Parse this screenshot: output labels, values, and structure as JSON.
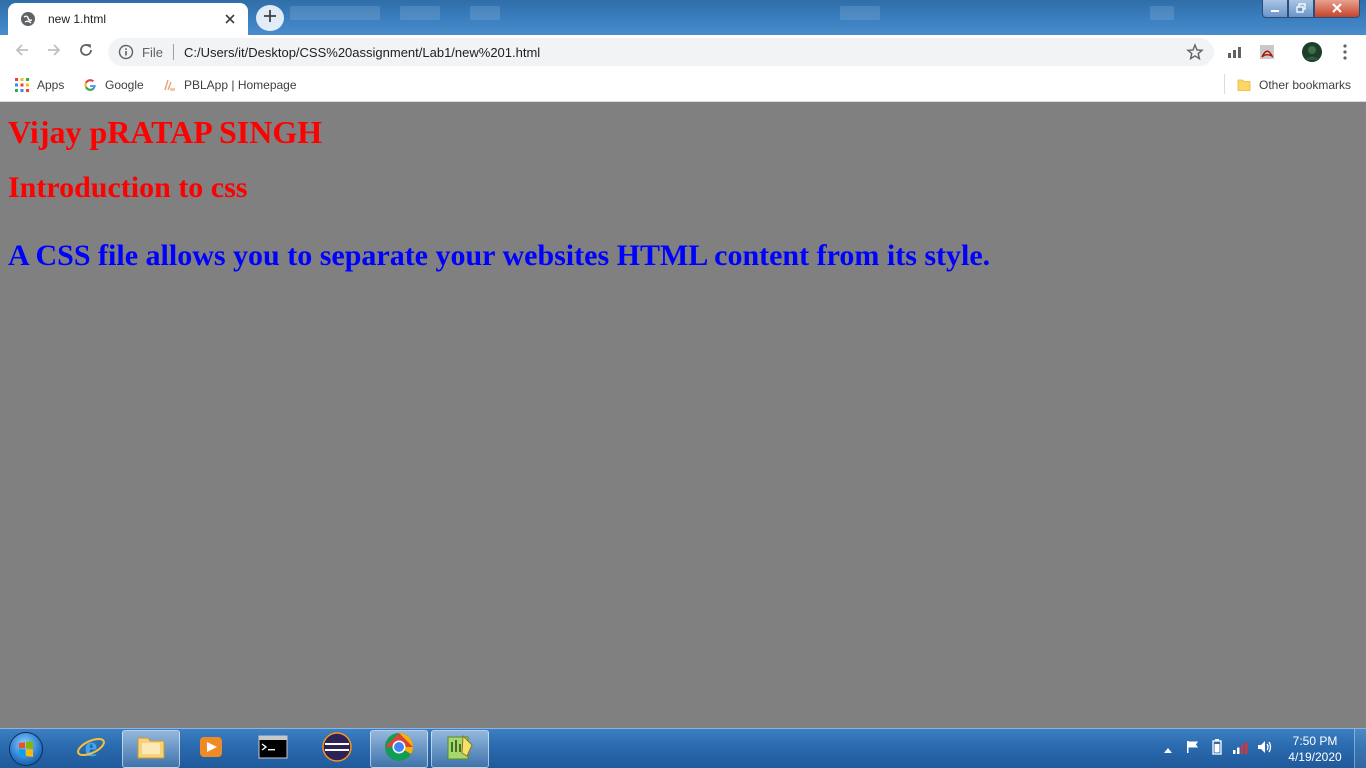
{
  "browser": {
    "tab": {
      "title": "new 1.html",
      "favicon": "globe-icon"
    },
    "new_tab_icon": "plus-icon",
    "window_controls": [
      "minimize-icon",
      "maximize-icon",
      "close-icon"
    ],
    "nav": {
      "back": "back-arrow-icon",
      "forward": "forward-arrow-icon",
      "reload": "reload-icon"
    },
    "address": {
      "scheme_label": "File",
      "url": "C:/Users/it/Desktop/CSS%20assignment/Lab1/new%201.html",
      "info_icon": "info-icon",
      "bookmark_icon": "star-icon"
    },
    "bookmarks": {
      "items": [
        {
          "label": "Apps",
          "icon": "apps-grid-icon"
        },
        {
          "label": "Google",
          "icon": "google-icon"
        },
        {
          "label": "PBLApp | Homepage",
          "icon": "pblapp-icon"
        }
      ],
      "other": {
        "label": "Other bookmarks",
        "icon": "folder-icon"
      }
    }
  },
  "page": {
    "background": "#808080",
    "heading1": "Vijay pRATAP SINGH",
    "heading2": "Introduction to css",
    "paragraph": "A CSS file allows you to separate your websites HTML content from its style.",
    "heading_color": "#ff0000",
    "paragraph_color": "#0000ff"
  },
  "taskbar": {
    "pinned": [
      "start-orb-icon",
      "file-explorer-icon",
      "ie-icon",
      "media-player-icon",
      "cmd-icon",
      "eclipse-icon",
      "chrome-icon",
      "notepadpp-icon"
    ],
    "clock": {
      "time": "7:50 PM",
      "date": "4/19/2020"
    }
  }
}
